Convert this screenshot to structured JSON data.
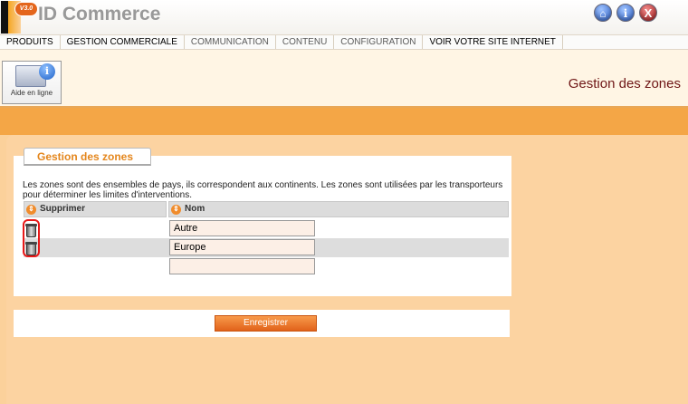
{
  "app": {
    "logo_badge": "V3.0",
    "logo_text": "ID Commerce",
    "accent_color": "#f4a646",
    "title_color": "#6f1616"
  },
  "top_icons": [
    {
      "name": "home-icon",
      "glyph": "⌂"
    },
    {
      "name": "info-icon",
      "glyph": "i"
    },
    {
      "name": "close-icon",
      "glyph": "X"
    }
  ],
  "menu": [
    {
      "label": "PRODUITS",
      "dim": false
    },
    {
      "label": "GESTION COMMERCIALE",
      "dim": false
    },
    {
      "label": "COMMUNICATION",
      "dim": true
    },
    {
      "label": "CONTENU",
      "dim": true
    },
    {
      "label": "CONFIGURATION",
      "dim": true
    },
    {
      "label": "VOIR VOTRE SITE INTERNET",
      "dim": false
    }
  ],
  "help": {
    "label": "Aide en ligne",
    "icon": "info-icon"
  },
  "page": {
    "title": "Gestion des zones"
  },
  "panel": {
    "tab_title": "Gestion des zones",
    "description": "Les zones sont des ensembles de pays, ils correspondent aux continents. Les zones sont utilisées par les transporteurs pour déterminer les limites d'interventions."
  },
  "table": {
    "columns": [
      "Supprimer",
      "Nom"
    ],
    "sort_glyph": "⇕",
    "rows": [
      {
        "nom": "Autre"
      },
      {
        "nom": "Europe"
      },
      {
        "nom": ""
      }
    ]
  },
  "footer": {
    "save_label": "Enregistrer"
  }
}
